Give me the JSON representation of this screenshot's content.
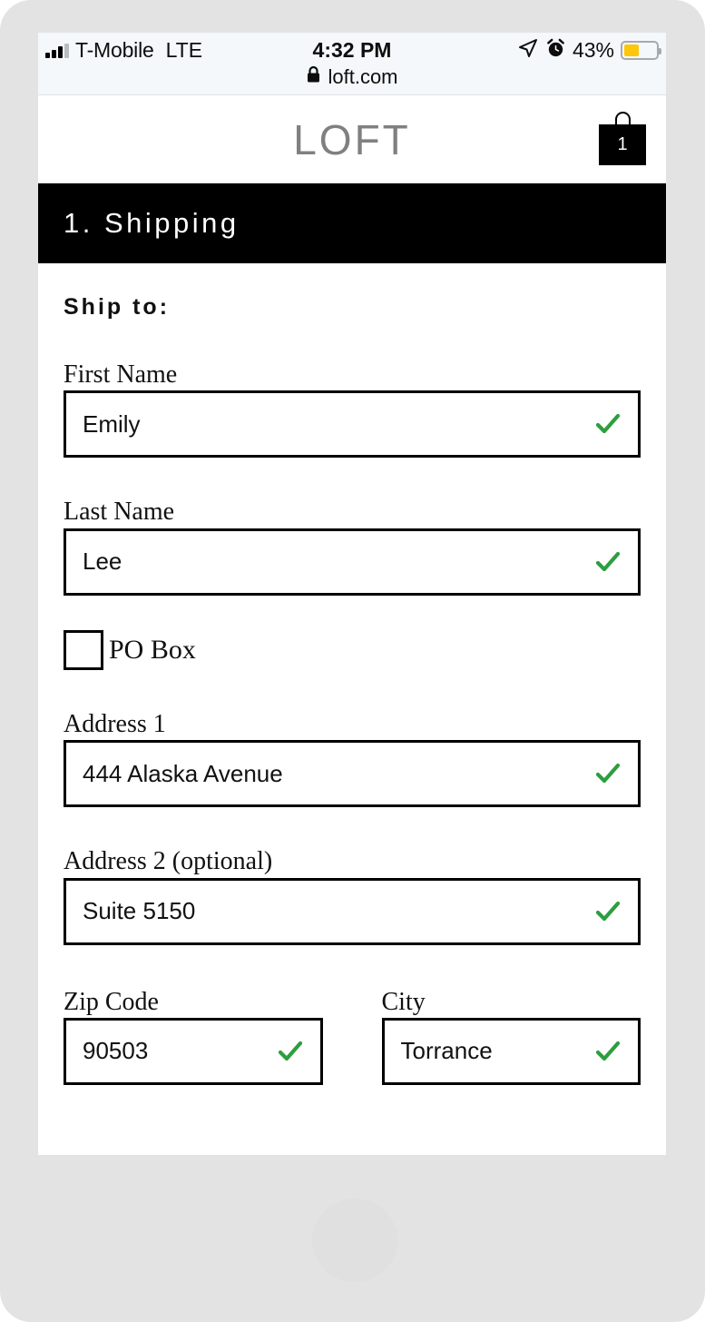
{
  "status_bar": {
    "carrier": "T-Mobile",
    "network": "LTE",
    "time": "4:32 PM",
    "battery_percent": "43%",
    "battery_level": 43,
    "url": "loft.com",
    "icons": {
      "signal": "signal-bars-icon",
      "location": "location-arrow-icon",
      "alarm": "alarm-clock-icon",
      "battery": "battery-icon",
      "lock": "lock-icon"
    }
  },
  "header": {
    "logo": "LOFT",
    "logo_color": "#808080",
    "cart_count": "1",
    "cart_icon": "shopping-bag-icon"
  },
  "step": {
    "title": "1. Shipping"
  },
  "form": {
    "section_label": "Ship to:",
    "checkmark_color": "#2d9e3f",
    "fields": [
      {
        "label": "First Name",
        "value": "Emily",
        "valid": true
      },
      {
        "label": "Last Name",
        "value": "Lee",
        "valid": true
      }
    ],
    "po_box": {
      "label": "PO Box",
      "checked": false
    },
    "address_fields": [
      {
        "label": "Address 1",
        "value": "444 Alaska Avenue",
        "valid": true
      },
      {
        "label": "Address 2 (optional)",
        "value": "Suite 5150",
        "valid": true
      }
    ],
    "bottom_row": [
      {
        "label": "Zip Code",
        "value": "90503",
        "valid": true
      },
      {
        "label": "City",
        "value": "Torrance",
        "valid": true
      }
    ]
  }
}
